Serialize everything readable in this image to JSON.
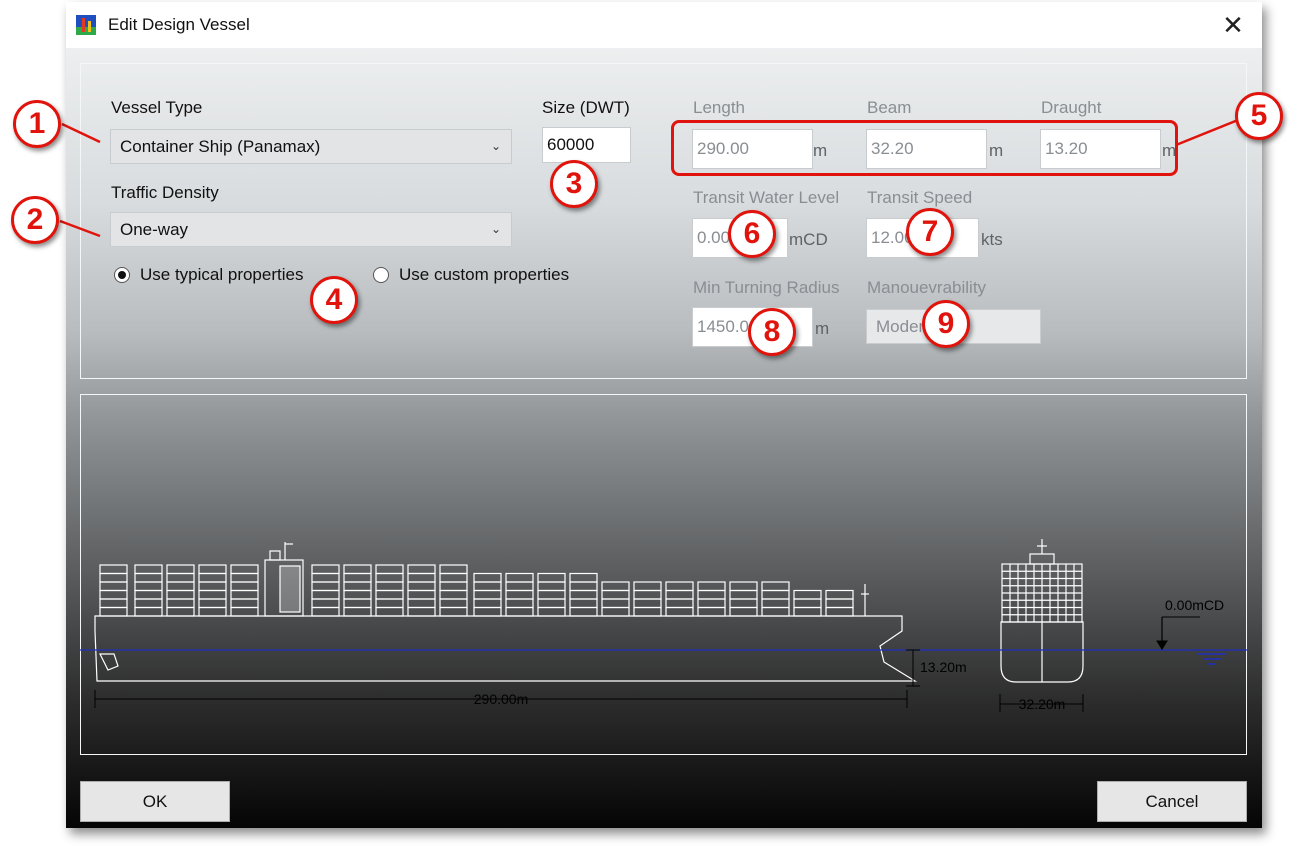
{
  "window": {
    "title": "Edit Design Vessel",
    "close_glyph": "✕"
  },
  "form": {
    "vessel_type": {
      "label": "Vessel Type",
      "value": "Container Ship (Panamax)"
    },
    "size": {
      "label": "Size (DWT)",
      "value": "60000"
    },
    "traffic_density": {
      "label": "Traffic Density",
      "value": "One-way"
    },
    "property_mode": {
      "typical_label": "Use typical properties",
      "custom_label": "Use custom properties",
      "selected": "typical"
    },
    "length": {
      "label": "Length",
      "value": "290.00",
      "unit": "m"
    },
    "beam": {
      "label": "Beam",
      "value": "32.20",
      "unit": "m"
    },
    "draught": {
      "label": "Draught",
      "value": "13.20",
      "unit": "m"
    },
    "transit_water_level": {
      "label": "Transit Water Level",
      "value": "0.00",
      "unit": "mCD"
    },
    "transit_speed": {
      "label": "Transit Speed",
      "value": "12.00",
      "unit": "kts"
    },
    "min_turning_radius": {
      "label": "Min Turning Radius",
      "value": "1450.00",
      "unit": "m"
    },
    "manoeuvrability": {
      "label": "Manouevrability",
      "value": "Moderate"
    }
  },
  "diagram": {
    "length_label": "290.00m",
    "draught_label": "13.20m",
    "beam_label": "32.20m",
    "water_level_label": "0.00mCD"
  },
  "buttons": {
    "ok": "OK",
    "cancel": "Cancel"
  },
  "annotations": [
    "1",
    "2",
    "3",
    "4",
    "5",
    "6",
    "7",
    "8",
    "9"
  ],
  "colors": {
    "callout": "#e0140c",
    "waterline": "#1e2fbf",
    "ship_outline": "#ffffff"
  }
}
